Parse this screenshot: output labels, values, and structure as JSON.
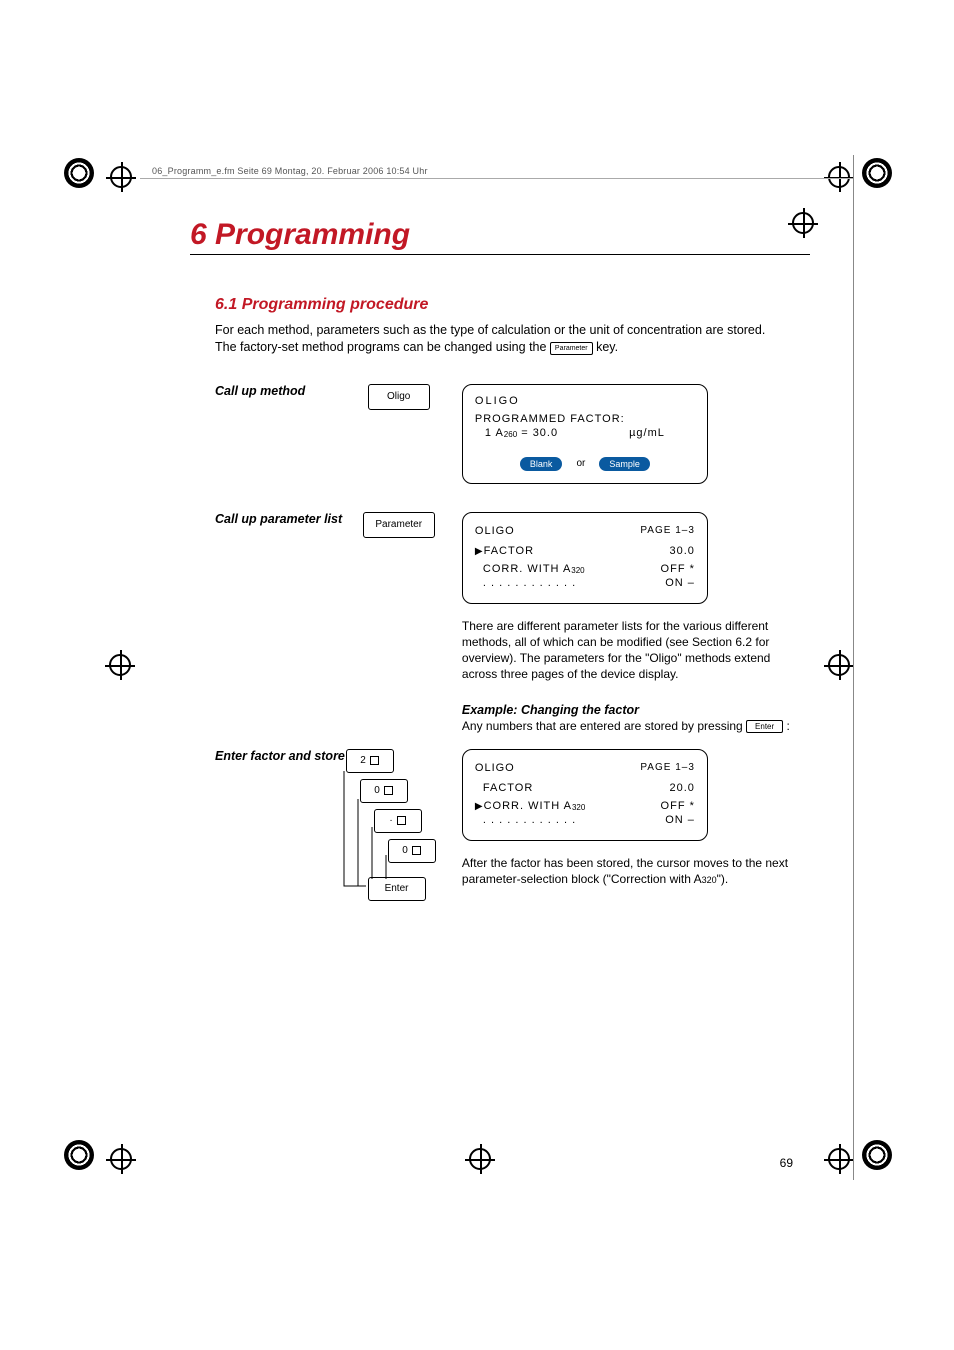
{
  "header": {
    "running_head": "06_Programm_e.fm  Seite 69  Montag, 20. Februar 2006  10:54 Uhr"
  },
  "chapter": {
    "number_title": "6  Programming"
  },
  "section": {
    "title": "6.1  Programming procedure",
    "intro_a": "For each method, parameters such as the type of calculation or the unit of concentration are stored. The factory-set method programs can be changed using the ",
    "intro_key": "Parameter",
    "intro_b": " key."
  },
  "steps": {
    "callup_method": {
      "label": "Call up method",
      "key": "Oligo",
      "screen": {
        "title": "OLIGO",
        "line1": "PROGRAMMED FACTOR:",
        "line2_left": "1   A",
        "line2_sub": "260",
        "line2_mid": " = 30.0",
        "line2_right": "µg/mL",
        "btn_blank": "Blank",
        "or": "or",
        "btn_sample": "Sample"
      }
    },
    "callup_params": {
      "label": "Call up parameter list",
      "key": "Parameter",
      "screen": {
        "title": "OLIGO",
        "page": "PAGE 1–3",
        "row1_l": "FACTOR",
        "row1_r": "30.0",
        "row2_l": "CORR. WITH A",
        "row2_sub": "320",
        "row2_r1": "OFF *",
        "row3_l": ". . . . . . . . . . . .",
        "row3_r": "ON –"
      },
      "para": "There are different parameter lists for the various different methods, all of which can be modified (see Section 6.2 for overview). The parameters for the \"Oligo\" methods extend across three pages of the device display."
    },
    "example": {
      "heading": "Example: Changing the factor",
      "line": "Any numbers that are entered are stored by pressing ",
      "enter_key": "Enter",
      "colon": " :"
    },
    "enter_factor": {
      "label": "Enter factor and store",
      "keys": {
        "k2": "2",
        "k0a": "0",
        "kdot": "·",
        "k0b": "0",
        "kenter": "Enter"
      },
      "screen": {
        "title": "OLIGO",
        "page": "PAGE 1–3",
        "row1_l": "FACTOR",
        "row1_r": "20.0",
        "row2_l": "CORR. WITH A",
        "row2_sub": "320",
        "row2_r1": "OFF *",
        "row3_l": ". . . . . . . . . . . .",
        "row3_r": "ON –"
      },
      "para_a": "After the factor has been stored, the cursor moves to the next parameter-selection block (\"Correction with A",
      "para_sub": "320",
      "para_b": "\")."
    }
  },
  "page_number": "69"
}
